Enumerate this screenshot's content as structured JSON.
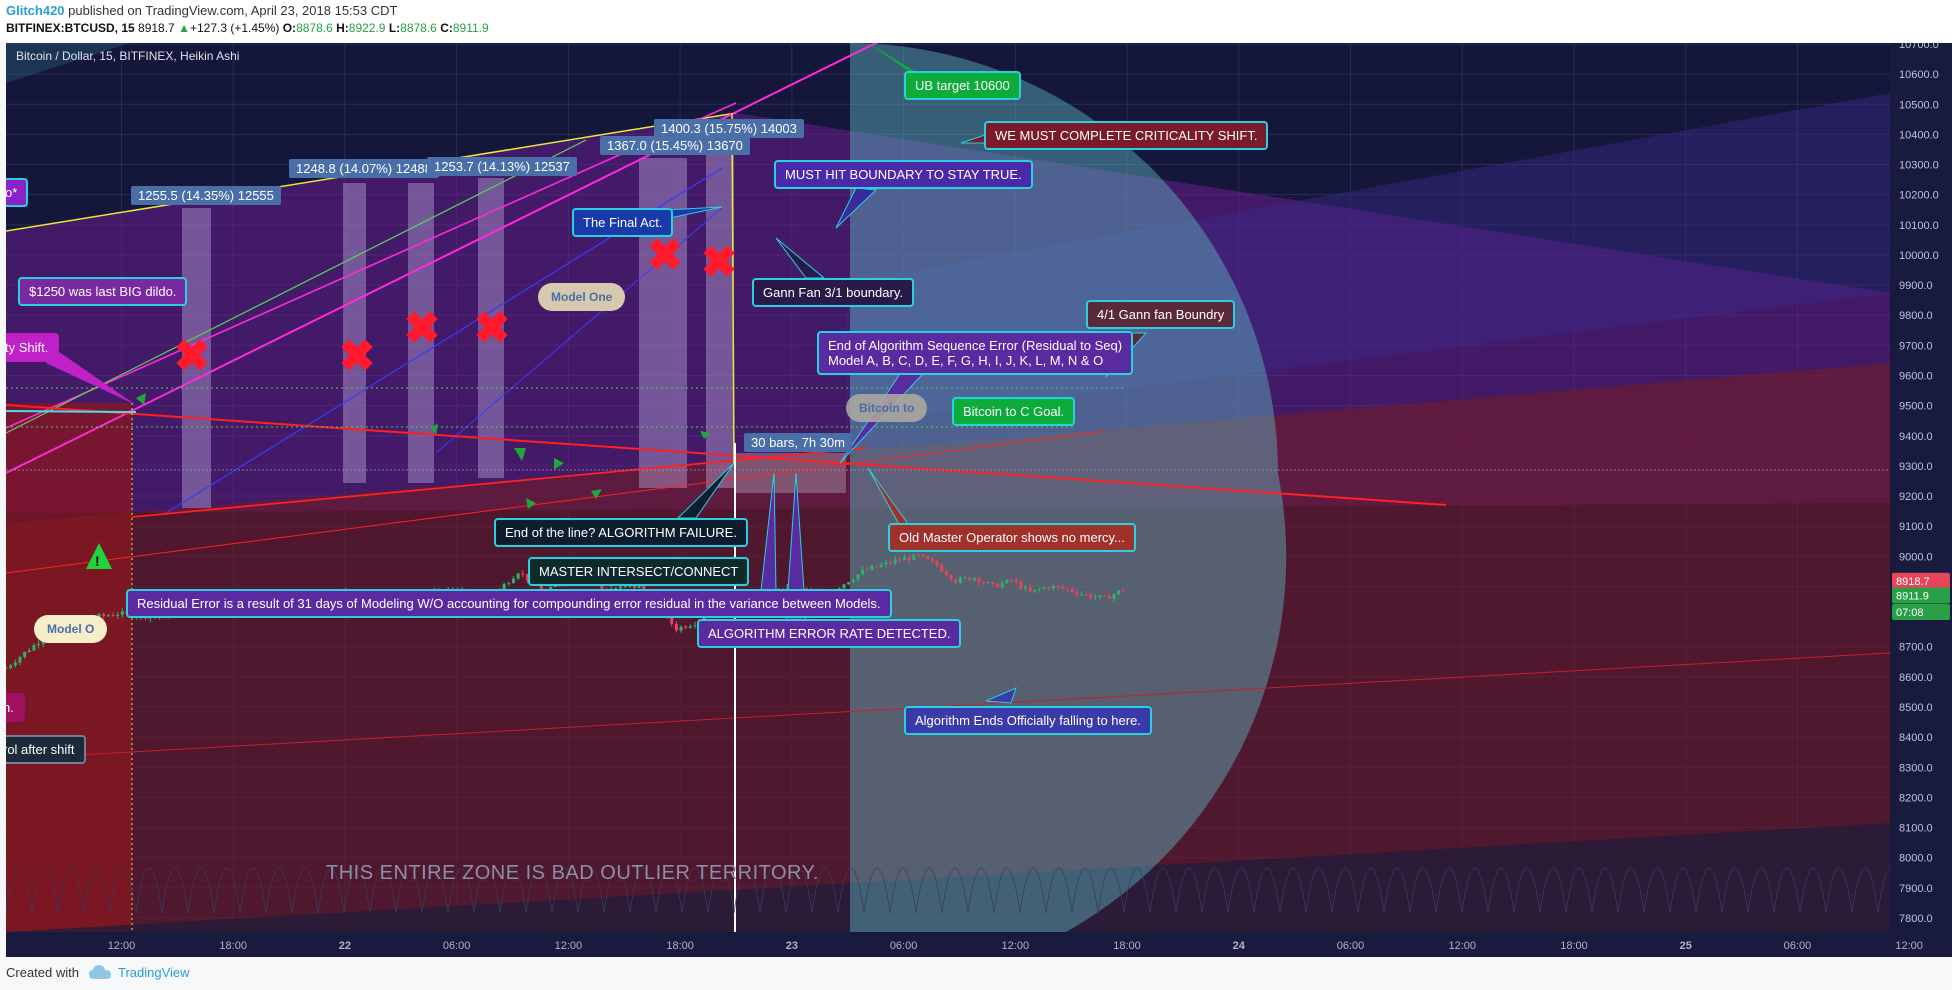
{
  "header": {
    "author": "Glitch420",
    "published": "published on TradingView.com, April 23, 2018 15:53 CDT",
    "symbol": "BITFINEX:BTCUSD, 15",
    "last": "8918.7",
    "change": "+127.3 (+1.45%)",
    "o_label": "O:",
    "o_val": "8878.6",
    "h_label": "H:",
    "h_val": "8922.9",
    "l_label": "L:",
    "l_val": "8878.6",
    "c_label": "C:",
    "c_val": "8911.9"
  },
  "footer": {
    "created_with": "Created with",
    "brand": "TradingView"
  },
  "chart_data": {
    "type": "line",
    "title": "Bitcoin / Dollar, 15, BITFINEX, Heikin Ashi",
    "ylim": [
      7750,
      10700
    ],
    "y_ticks": [
      10700,
      10600,
      10500,
      10400,
      10300,
      10200,
      10100,
      10000,
      9900,
      9800,
      9700,
      9600,
      9500,
      9400,
      9300,
      9200,
      9100,
      9000,
      8900,
      8700,
      8600,
      8500,
      8400,
      8300,
      8200,
      8100,
      8000,
      7900,
      7800
    ],
    "x_ticks": [
      "12:00",
      "18:00",
      "22",
      "06:00",
      "12:00",
      "18:00",
      "23",
      "06:00",
      "12:00",
      "18:00",
      "24",
      "06:00",
      "12:00",
      "18:00",
      "25",
      "06:00",
      "12:00"
    ],
    "x_tick_pos": [
      0.2,
      6.2,
      12.2,
      18.2,
      24.2,
      30.2,
      36.2,
      42.2,
      48.2,
      54.2,
      60.2,
      66.2,
      72.2,
      78.2,
      84.2,
      90.2,
      96.2
    ],
    "xlim": [
      -6,
      98.5
    ],
    "price_badges": [
      {
        "value": "8918.7",
        "price": 8918.7,
        "color": "#e8455a"
      },
      {
        "value": "8911.9",
        "price": 8870,
        "color": "#27a046"
      },
      {
        "value": "07:08",
        "price": 8815,
        "color": "#27a046"
      }
    ],
    "series": {
      "t": [
        -6,
        -4,
        -2,
        0,
        2,
        4,
        6,
        8,
        10,
        12,
        14,
        16,
        18,
        20,
        21.5,
        23,
        24,
        25,
        26,
        28,
        30,
        31,
        32,
        34,
        36,
        38,
        40,
        42,
        43,
        44,
        45,
        46,
        47,
        48,
        49,
        50,
        51,
        52,
        53,
        54
      ],
      "price": [
        8630,
        8730,
        8790,
        8810,
        8800,
        8820,
        8870,
        8840,
        8860,
        8880,
        8850,
        8870,
        8890,
        8860,
        8950,
        8880,
        8920,
        8960,
        8890,
        8900,
        8760,
        8780,
        8830,
        8840,
        8900,
        8870,
        8950,
        8990,
        9000,
        8970,
        8920,
        8930,
        8900,
        8920,
        8880,
        8900,
        8890,
        8870,
        8860,
        8890
      ]
    },
    "range_tags": [
      {
        "text": "1255.5 (14.35%) 12555"
      },
      {
        "text": "1248.8 (14.07%) 12488"
      },
      {
        "text": "1253.7 (14.13%) 12537"
      },
      {
        "text": "1367.0 (15.45%) 13670"
      },
      {
        "text": "1400.3 (15.75%) 14003"
      },
      {
        "text": "30 bars, 7h 30m"
      }
    ],
    "annotations": [
      {
        "text": "UB target 10600"
      },
      {
        "text": "WE MUST COMPLETE CRITICALITY SHIFT."
      },
      {
        "text": "MUST HIT BOUNDARY TO STAY TRUE."
      },
      {
        "text": "The Final Act."
      },
      {
        "text": "Gann Fan 3/1 boundary."
      },
      {
        "text": "4/1 Gann fan Boundry"
      },
      {
        "text": "End of Algorithm Sequence  Error (Residual to Seq)"
      },
      {
        "text": "Model A, B, C, D, E, F, G, H, I, J, K, L, M, N & O"
      },
      {
        "text": "Bitcoin to C Goal."
      },
      {
        "text": "$1250 was last BIG dildo."
      },
      {
        "text": "ty Shift."
      },
      {
        "text": "End of the line? ALGORITHM FAILURE."
      },
      {
        "text": "MASTER INTERSECT/CONNECT"
      },
      {
        "text": "Residual Error is a result of 31 days of Modeling W/O accounting for compounding error residual in the variance between Models."
      },
      {
        "text": "ALGORITHM ERROR RATE DETECTED."
      },
      {
        "text": "Old Master Operator shows no mercy..."
      },
      {
        "text": "Algorithm Ends Officially falling to here."
      },
      {
        "text": "o*"
      },
      {
        "text": "n."
      },
      {
        "text": "rol after shift"
      },
      {
        "text": "Model One"
      },
      {
        "text": "Model O"
      },
      {
        "text": "Bitcoin to"
      },
      {
        "text": "THIS ENTIRE ZONE IS BAD OUTLIER TERRITORY."
      }
    ]
  },
  "colors": {
    "background": "#14163a",
    "candle_up": "#2bb56a",
    "candle_down": "#e8455a",
    "channel": "#c53be0",
    "cyan_zone": "#57b7c2",
    "red_zone": "#7a1a25"
  }
}
